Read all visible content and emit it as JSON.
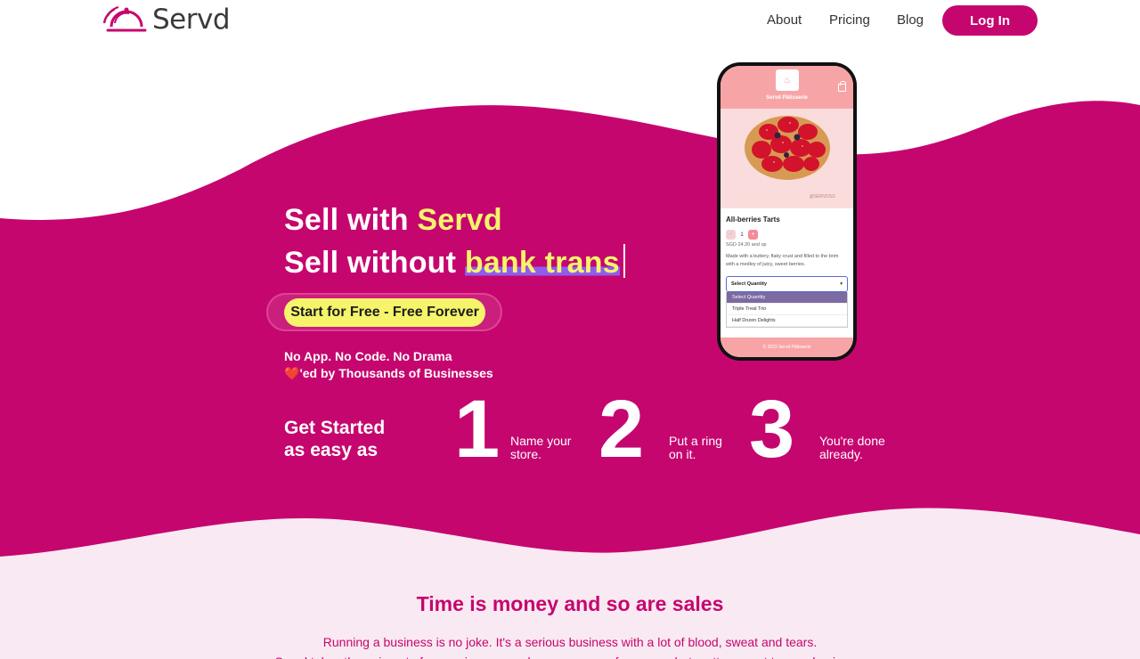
{
  "brand": {
    "name": "Servd",
    "accent": "#c5066f",
    "highlight": "#f5f46b",
    "underline": "#8f5cf0"
  },
  "nav": {
    "about": "About",
    "pricing": "Pricing",
    "blog": "Blog",
    "login": "Log In"
  },
  "hero": {
    "line1_prefix": "Sell with ",
    "line1_highlight": "Servd",
    "line2_prefix": "Sell without ",
    "line2_typed": "bank trans",
    "cta": "Start for Free - Free Forever",
    "sub1": "No App. No Code. No Drama",
    "sub2_heart": "❤️",
    "sub2_text": "'ed by Thousands of Businesses"
  },
  "steps": {
    "title_line1": "Get Started",
    "title_line2": "as easy as",
    "items": [
      {
        "num": "1",
        "label_l1": "Name your",
        "label_l2": "store."
      },
      {
        "num": "2",
        "label_l1": "Put a ring",
        "label_l2": "on it."
      },
      {
        "num": "3",
        "label_l1": "You're done",
        "label_l2": "already."
      }
    ]
  },
  "phone": {
    "shop_name": "Servd Pâtisserie",
    "product_credit": "@SERVDSG",
    "product_name": "All-berries Tarts",
    "quantity": "1",
    "minus": "-",
    "plus": "+",
    "price": "SGD 24.20 and up",
    "description": "Made with a buttery, flaky crust and filled to the brim with a medley of juicy, sweet berries.",
    "select_label": "Select Quantity",
    "options": [
      "Select Quantity",
      "Triple Treat Trio",
      "Half Dozen Delights"
    ],
    "footer": "© 2023 Servd Pâtisserie",
    "screen_header_color": "#f7a4a6"
  },
  "section": {
    "title": "Time is money and so are sales",
    "text1": "Running a business is no joke. It's a serious business with a lot of blood, sweat and tears.",
    "text2": "Servd takes the pain out of managing your orders so you can focus on what matters most to your business.",
    "background": "#f9e9f2"
  }
}
